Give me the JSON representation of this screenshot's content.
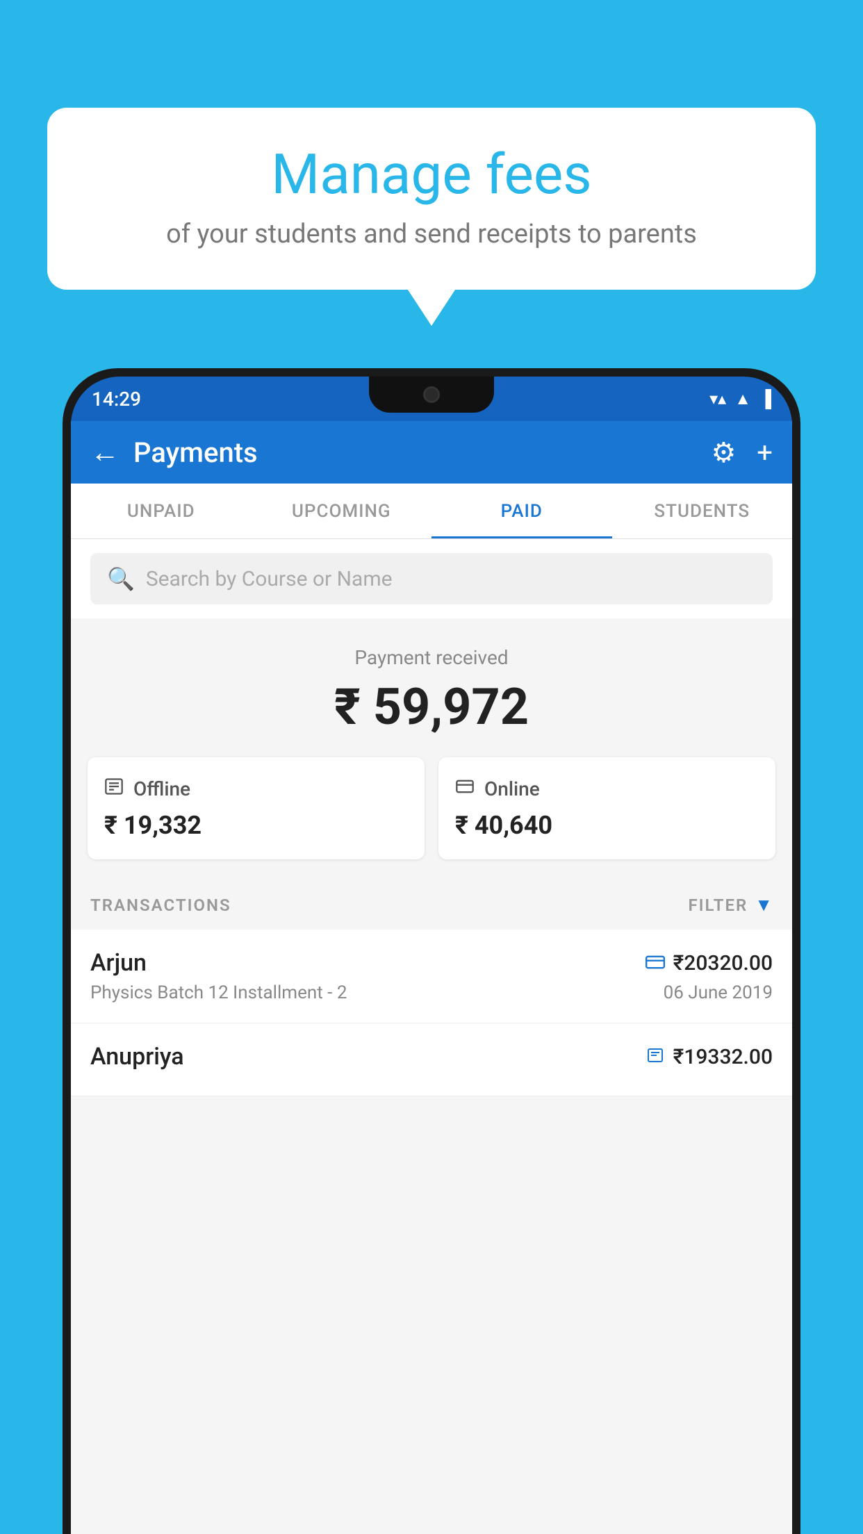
{
  "background_color": "#29b6e8",
  "bubble": {
    "title": "Manage fees",
    "subtitle": "of your students and send receipts to parents"
  },
  "status_bar": {
    "time": "14:29",
    "icons": [
      "wifi",
      "signal",
      "battery"
    ]
  },
  "header": {
    "title": "Payments",
    "back_label": "←",
    "gear_label": "⚙",
    "plus_label": "+"
  },
  "tabs": [
    {
      "label": "UNPAID",
      "active": false
    },
    {
      "label": "UPCOMING",
      "active": false
    },
    {
      "label": "PAID",
      "active": true
    },
    {
      "label": "STUDENTS",
      "active": false
    }
  ],
  "search": {
    "placeholder": "Search by Course or Name"
  },
  "payment": {
    "label": "Payment received",
    "amount": "₹ 59,972",
    "offline_label": "Offline",
    "offline_amount": "₹ 19,332",
    "online_label": "Online",
    "online_amount": "₹ 40,640"
  },
  "transactions": {
    "header_label": "TRANSACTIONS",
    "filter_label": "FILTER",
    "items": [
      {
        "name": "Arjun",
        "detail": "Physics Batch 12 Installment - 2",
        "amount": "₹20320.00",
        "date": "06 June 2019",
        "payment_type": "online"
      },
      {
        "name": "Anupriya",
        "detail": "",
        "amount": "₹19332.00",
        "date": "",
        "payment_type": "offline"
      }
    ]
  }
}
